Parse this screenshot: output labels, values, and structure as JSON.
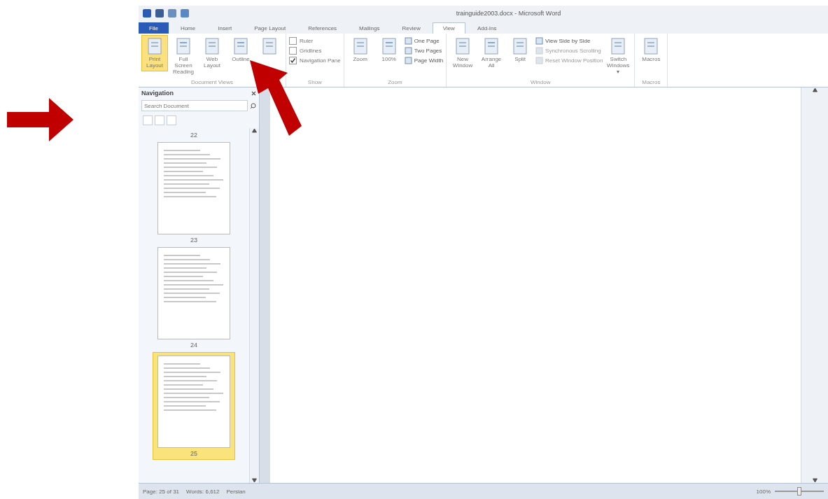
{
  "window": {
    "title": "trainguide2003.docx - Microsoft Word"
  },
  "tabs": [
    {
      "label": "File",
      "kind": "file",
      "selected": false
    },
    {
      "label": "Home",
      "kind": "tab",
      "selected": false
    },
    {
      "label": "Insert",
      "kind": "tab",
      "selected": false
    },
    {
      "label": "Page Layout",
      "kind": "tab",
      "selected": false
    },
    {
      "label": "References",
      "kind": "tab",
      "selected": false
    },
    {
      "label": "Mailings",
      "kind": "tab",
      "selected": false
    },
    {
      "label": "Review",
      "kind": "tab",
      "selected": false
    },
    {
      "label": "View",
      "kind": "tab",
      "selected": true
    },
    {
      "label": "Add-Ins",
      "kind": "tab",
      "selected": false
    }
  ],
  "ribbon": [
    {
      "label": "Document Views",
      "items": [
        {
          "kind": "large",
          "label": "Print Layout",
          "selected": true
        },
        {
          "kind": "large",
          "label": "Full Screen Reading",
          "selected": false
        },
        {
          "kind": "large",
          "label": "Web Layout",
          "selected": false
        },
        {
          "kind": "large",
          "label": "Outline",
          "selected": false
        },
        {
          "kind": "large",
          "selected": false
        }
      ]
    },
    {
      "label": "Show",
      "items": [
        {
          "kind": "check",
          "label": "Ruler",
          "checked": false
        },
        {
          "kind": "check",
          "label": "Gridlines",
          "checked": false
        },
        {
          "kind": "check",
          "label": "Navigation Pane",
          "checked": true
        }
      ]
    },
    {
      "label": "Zoom",
      "items": [
        {
          "kind": "large",
          "label": "Zoom",
          "selected": false
        },
        {
          "kind": "large",
          "label": "100%",
          "selected": false
        },
        {
          "kind": "small",
          "label": "One Page",
          "disabled": false
        },
        {
          "kind": "small",
          "label": "Two Pages",
          "disabled": false
        },
        {
          "kind": "small",
          "label": "Page Width",
          "disabled": false
        }
      ]
    },
    {
      "label": "Window",
      "items": [
        {
          "kind": "large",
          "label": "New Window",
          "selected": false
        },
        {
          "kind": "large",
          "label": "Arrange All",
          "selected": false
        },
        {
          "kind": "large",
          "label": "Split",
          "selected": false
        },
        {
          "kind": "small",
          "label": "View Side by Side",
          "disabled": false
        },
        {
          "kind": "small",
          "label": "Synchronous Scrolling",
          "disabled": true
        },
        {
          "kind": "small",
          "label": "Reset Window Position",
          "disabled": true
        },
        {
          "kind": "large",
          "label": "Switch Windows ▾",
          "selected": false
        }
      ]
    },
    {
      "label": "Macros",
      "items": [
        {
          "kind": "large",
          "label": "Macros",
          "selected": false
        }
      ]
    }
  ],
  "navigation": {
    "title": "Navigation",
    "search": {
      "placeholder": "Search Document"
    },
    "pages": [
      {
        "number": "22",
        "selected": false
      },
      {
        "number": "23",
        "selected": false
      },
      {
        "number": "24",
        "selected": false
      },
      {
        "number": "25",
        "selected": true
      }
    ]
  },
  "status_bar": {
    "page": "Page: 25 of 31",
    "words": "Words: 6,612",
    "language": "Persian",
    "zoom": "100%",
    "zoom_slider": {
      "level": 0.5
    }
  }
}
